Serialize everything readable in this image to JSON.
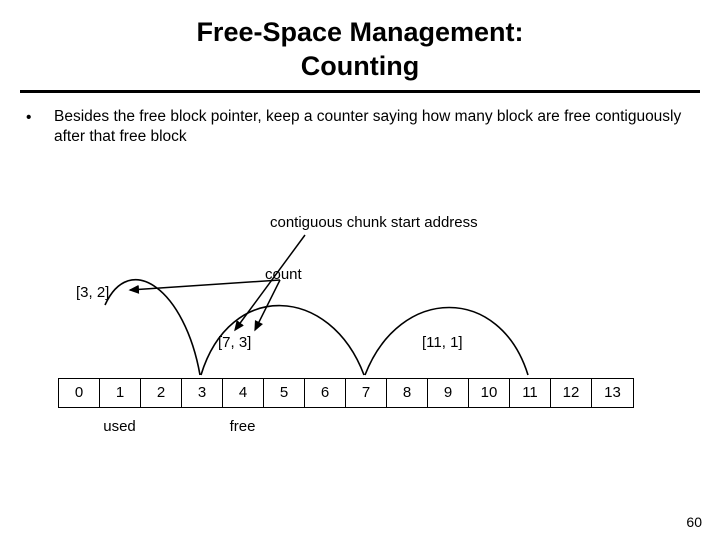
{
  "title_line1": "Free-Space Management:",
  "title_line2": "Counting",
  "bullet": "Besides the free block pointer, keep a counter saying how many block are free contiguously after that free block",
  "label_chunk": "contiguous chunk start address",
  "label_count": "count",
  "pair1": "[3, 2]",
  "pair2": "[7, 3]",
  "pair3": "[11, 1]",
  "cells": [
    "0",
    "1",
    "2",
    "3",
    "4",
    "5",
    "6",
    "7",
    "8",
    "9",
    "10",
    "11",
    "12",
    "13"
  ],
  "label_used": "used",
  "label_free": "free",
  "page": "60"
}
